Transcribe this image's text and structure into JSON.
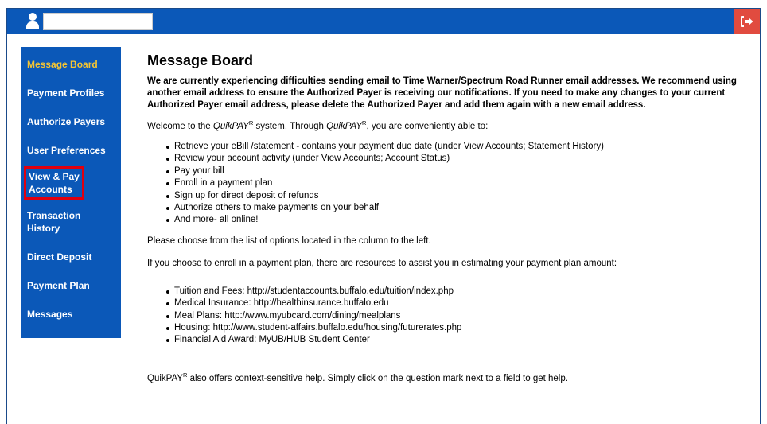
{
  "header": {
    "logout_icon": "sign-out-icon",
    "user_icon": "user-icon"
  },
  "sidebar": {
    "items": [
      {
        "label": "Message Board",
        "active": true
      },
      {
        "label": "Payment Profiles"
      },
      {
        "label": "Authorize Payers"
      },
      {
        "label": "User Preferences"
      },
      {
        "label": "View & Pay Accounts",
        "highlighted": true
      },
      {
        "label": "Transaction History"
      },
      {
        "label": "Direct Deposit"
      },
      {
        "label": "Payment Plan"
      },
      {
        "label": "Messages"
      }
    ]
  },
  "main": {
    "title": "Message Board",
    "notice": "We are currently experiencing difficulties sending email to Time Warner/Spectrum Road Runner email addresses. We recommend using another email address to ensure the Authorized Payer is receiving our notifications. If you need to make any changes to your current Authorized Payer email address, please delete the Authorized Payer and add them again with a new email address.",
    "welcome_prefix": "Welcome to the ",
    "brand": "QuikPAY",
    "brand_sup": "R",
    "welcome_mid": " system. Through ",
    "welcome_suffix": ", you are conveniently able to:",
    "features": [
      "Retrieve your eBill /statement - contains your payment due date (under View Accounts; Statement History)",
      "Review your account activity (under View Accounts; Account Status)",
      "Pay your bill",
      "Enroll in a payment plan",
      "Sign up for direct deposit of refunds",
      "Authorize others to make payments on your behalf",
      "And more- all online!"
    ],
    "choose_text": "Please choose from the list of options located in the column to the left.",
    "resources_intro": "If you choose to enroll in a payment plan, there are resources to assist you in estimating your payment plan amount:",
    "resources": [
      "Tuition and Fees: http://studentaccounts.buffalo.edu/tuition/index.php",
      "Medical Insurance: http://healthinsurance.buffalo.edu",
      "Meal Plans: http://www.myubcard.com/dining/mealplans",
      "Housing: http://www.student-affairs.buffalo.edu/housing/futurerates.php",
      "Financial Aid Award: MyUB/HUB Student Center"
    ],
    "help_suffix": " also offers context-sensitive help. Simply click on the question mark next to a field to get help."
  },
  "colors": {
    "brand_blue": "#0b58b8",
    "active_nav": "#f5c533",
    "logout_red": "#e14b3f",
    "highlight_red": "#e0000f"
  }
}
